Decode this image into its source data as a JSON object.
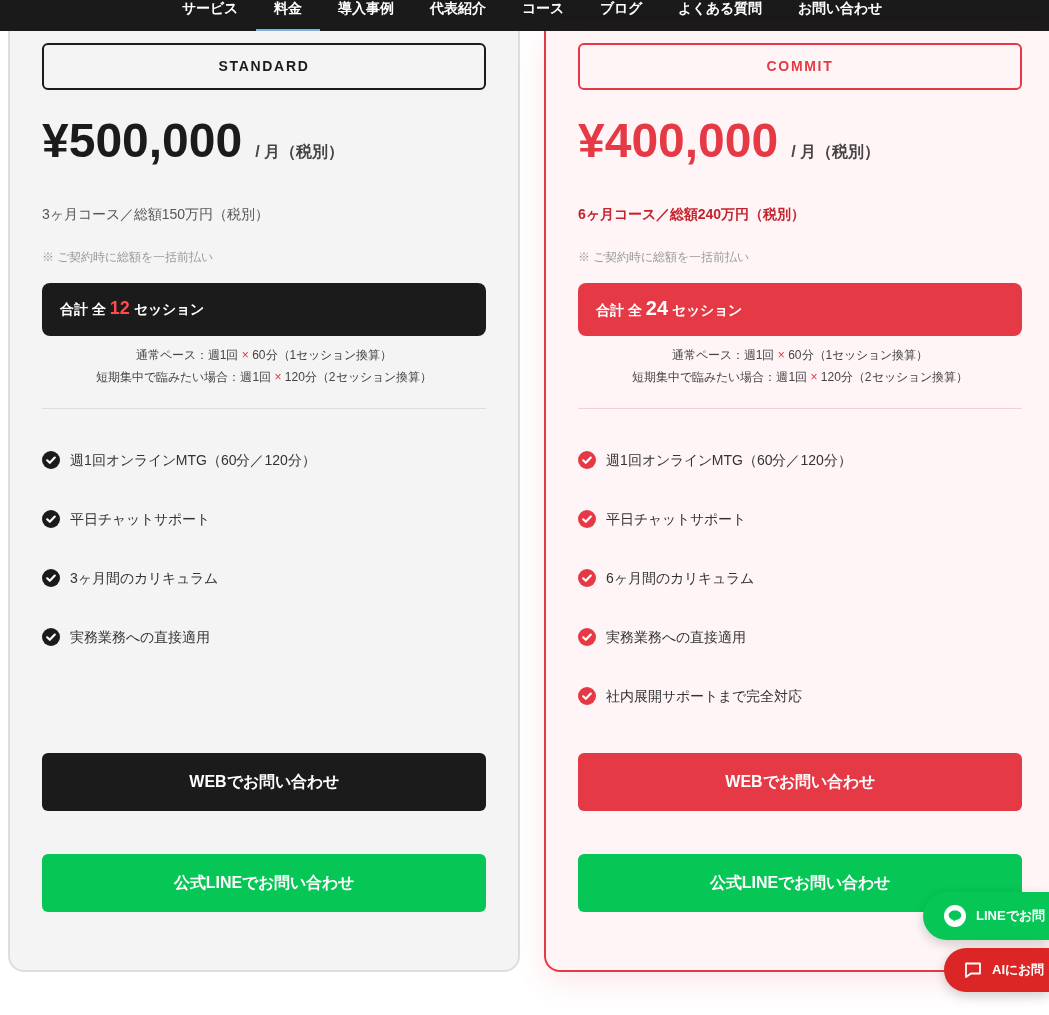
{
  "nav": {
    "items": [
      {
        "label": "サービス",
        "selected": false
      },
      {
        "label": "料金",
        "selected": true
      },
      {
        "label": "導入事例",
        "selected": false
      },
      {
        "label": "代表紹介",
        "selected": false
      },
      {
        "label": "コース",
        "selected": false
      },
      {
        "label": "ブログ",
        "selected": false
      },
      {
        "label": "よくある質問",
        "selected": false
      },
      {
        "label": "お問い合わせ",
        "selected": false
      }
    ]
  },
  "plans": [
    {
      "kind": "standard",
      "name": "STANDARD",
      "price": "¥500,000",
      "price_unit": "/ 月（税別）",
      "course": "3ヶ月コース／総額150万円（税別）",
      "payment_note": "※ ご契約時に総額を一括前払い",
      "sessions": {
        "prefix": "合計 全",
        "count": "12",
        "suffix": "セッション"
      },
      "pace_notes": [
        {
          "before": "通常ペース：週1回",
          "mark": "×",
          "after": "60分（1セッション換算）"
        },
        {
          "before": "短期集中で臨みたい場合：週1回",
          "mark": "×",
          "after": "120分（2セッション換算）"
        }
      ],
      "features": [
        "週1回オンラインMTG（60分／120分）",
        "平日チャットサポート",
        "3ヶ月間のカリキュラム",
        "実務業務への直接適用"
      ],
      "buttons": [
        {
          "kind": "web",
          "label": "WEBでお問い合わせ"
        },
        {
          "kind": "line",
          "label": "公式LINEでお問い合わせ"
        }
      ]
    },
    {
      "kind": "featured",
      "name": "COMMIT",
      "price": "¥400,000",
      "price_unit": "/ 月（税別）",
      "course": "6ヶ月コース／総額240万円（税別）",
      "payment_note": "※ ご契約時に総額を一括前払い",
      "sessions": {
        "prefix": "合計 全",
        "count": "24",
        "suffix": "セッション"
      },
      "pace_notes": [
        {
          "before": "通常ペース：週1回",
          "mark": "×",
          "after": "60分（1セッション換算）"
        },
        {
          "before": "短期集中で臨みたい場合：週1回",
          "mark": "×",
          "after": "120分（2セッション換算）"
        }
      ],
      "features": [
        "週1回オンラインMTG（60分／120分）",
        "平日チャットサポート",
        "6ヶ月間のカリキュラム",
        "実務業務への直接適用",
        "社内展開サポートまで完全対応"
      ],
      "buttons": [
        {
          "kind": "web",
          "label": "WEBでお問い合わせ"
        },
        {
          "kind": "line",
          "label": "公式LINEでお問い合わせ"
        }
      ]
    }
  ],
  "floating_buttons": [
    {
      "kind": "line",
      "label": "LINEでお問"
    },
    {
      "kind": "ai",
      "label": "AIにお問"
    }
  ]
}
